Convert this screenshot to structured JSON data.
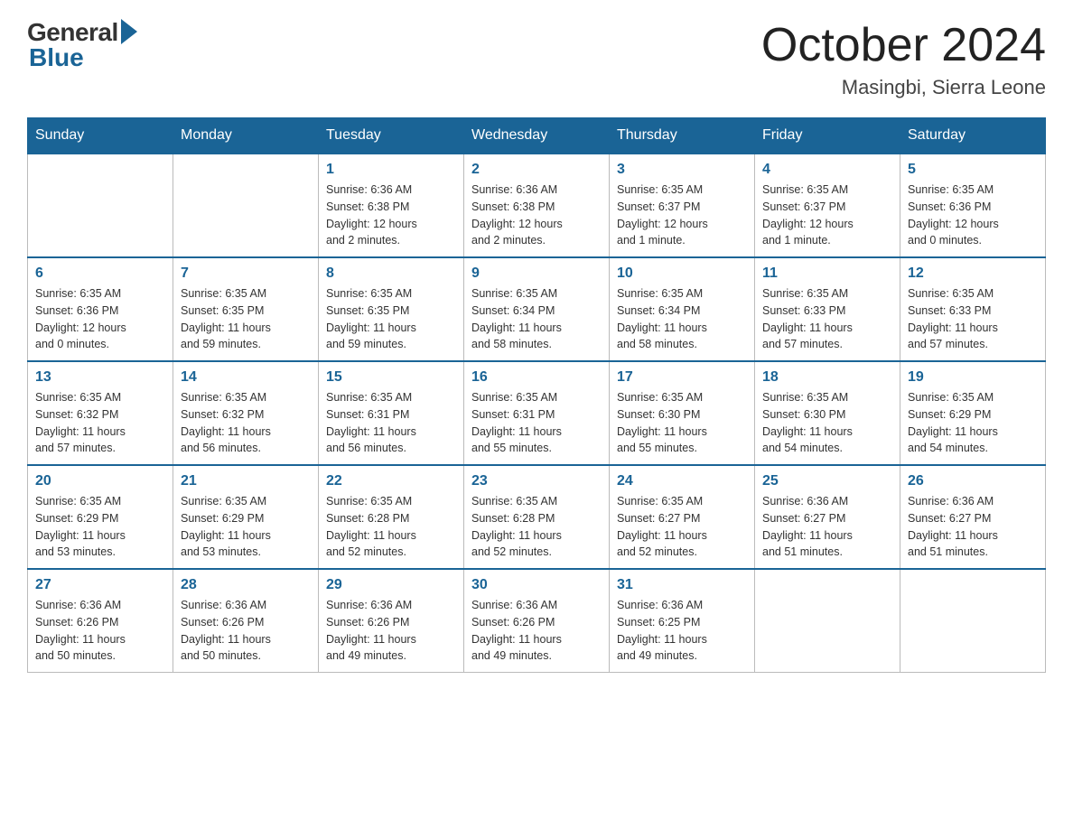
{
  "logo": {
    "general": "General",
    "blue": "Blue"
  },
  "header": {
    "month": "October 2024",
    "location": "Masingbi, Sierra Leone"
  },
  "weekdays": [
    "Sunday",
    "Monday",
    "Tuesday",
    "Wednesday",
    "Thursday",
    "Friday",
    "Saturday"
  ],
  "weeks": [
    [
      {
        "day": "",
        "info": ""
      },
      {
        "day": "",
        "info": ""
      },
      {
        "day": "1",
        "info": "Sunrise: 6:36 AM\nSunset: 6:38 PM\nDaylight: 12 hours\nand 2 minutes."
      },
      {
        "day": "2",
        "info": "Sunrise: 6:36 AM\nSunset: 6:38 PM\nDaylight: 12 hours\nand 2 minutes."
      },
      {
        "day": "3",
        "info": "Sunrise: 6:35 AM\nSunset: 6:37 PM\nDaylight: 12 hours\nand 1 minute."
      },
      {
        "day": "4",
        "info": "Sunrise: 6:35 AM\nSunset: 6:37 PM\nDaylight: 12 hours\nand 1 minute."
      },
      {
        "day": "5",
        "info": "Sunrise: 6:35 AM\nSunset: 6:36 PM\nDaylight: 12 hours\nand 0 minutes."
      }
    ],
    [
      {
        "day": "6",
        "info": "Sunrise: 6:35 AM\nSunset: 6:36 PM\nDaylight: 12 hours\nand 0 minutes."
      },
      {
        "day": "7",
        "info": "Sunrise: 6:35 AM\nSunset: 6:35 PM\nDaylight: 11 hours\nand 59 minutes."
      },
      {
        "day": "8",
        "info": "Sunrise: 6:35 AM\nSunset: 6:35 PM\nDaylight: 11 hours\nand 59 minutes."
      },
      {
        "day": "9",
        "info": "Sunrise: 6:35 AM\nSunset: 6:34 PM\nDaylight: 11 hours\nand 58 minutes."
      },
      {
        "day": "10",
        "info": "Sunrise: 6:35 AM\nSunset: 6:34 PM\nDaylight: 11 hours\nand 58 minutes."
      },
      {
        "day": "11",
        "info": "Sunrise: 6:35 AM\nSunset: 6:33 PM\nDaylight: 11 hours\nand 57 minutes."
      },
      {
        "day": "12",
        "info": "Sunrise: 6:35 AM\nSunset: 6:33 PM\nDaylight: 11 hours\nand 57 minutes."
      }
    ],
    [
      {
        "day": "13",
        "info": "Sunrise: 6:35 AM\nSunset: 6:32 PM\nDaylight: 11 hours\nand 57 minutes."
      },
      {
        "day": "14",
        "info": "Sunrise: 6:35 AM\nSunset: 6:32 PM\nDaylight: 11 hours\nand 56 minutes."
      },
      {
        "day": "15",
        "info": "Sunrise: 6:35 AM\nSunset: 6:31 PM\nDaylight: 11 hours\nand 56 minutes."
      },
      {
        "day": "16",
        "info": "Sunrise: 6:35 AM\nSunset: 6:31 PM\nDaylight: 11 hours\nand 55 minutes."
      },
      {
        "day": "17",
        "info": "Sunrise: 6:35 AM\nSunset: 6:30 PM\nDaylight: 11 hours\nand 55 minutes."
      },
      {
        "day": "18",
        "info": "Sunrise: 6:35 AM\nSunset: 6:30 PM\nDaylight: 11 hours\nand 54 minutes."
      },
      {
        "day": "19",
        "info": "Sunrise: 6:35 AM\nSunset: 6:29 PM\nDaylight: 11 hours\nand 54 minutes."
      }
    ],
    [
      {
        "day": "20",
        "info": "Sunrise: 6:35 AM\nSunset: 6:29 PM\nDaylight: 11 hours\nand 53 minutes."
      },
      {
        "day": "21",
        "info": "Sunrise: 6:35 AM\nSunset: 6:29 PM\nDaylight: 11 hours\nand 53 minutes."
      },
      {
        "day": "22",
        "info": "Sunrise: 6:35 AM\nSunset: 6:28 PM\nDaylight: 11 hours\nand 52 minutes."
      },
      {
        "day": "23",
        "info": "Sunrise: 6:35 AM\nSunset: 6:28 PM\nDaylight: 11 hours\nand 52 minutes."
      },
      {
        "day": "24",
        "info": "Sunrise: 6:35 AM\nSunset: 6:27 PM\nDaylight: 11 hours\nand 52 minutes."
      },
      {
        "day": "25",
        "info": "Sunrise: 6:36 AM\nSunset: 6:27 PM\nDaylight: 11 hours\nand 51 minutes."
      },
      {
        "day": "26",
        "info": "Sunrise: 6:36 AM\nSunset: 6:27 PM\nDaylight: 11 hours\nand 51 minutes."
      }
    ],
    [
      {
        "day": "27",
        "info": "Sunrise: 6:36 AM\nSunset: 6:26 PM\nDaylight: 11 hours\nand 50 minutes."
      },
      {
        "day": "28",
        "info": "Sunrise: 6:36 AM\nSunset: 6:26 PM\nDaylight: 11 hours\nand 50 minutes."
      },
      {
        "day": "29",
        "info": "Sunrise: 6:36 AM\nSunset: 6:26 PM\nDaylight: 11 hours\nand 49 minutes."
      },
      {
        "day": "30",
        "info": "Sunrise: 6:36 AM\nSunset: 6:26 PM\nDaylight: 11 hours\nand 49 minutes."
      },
      {
        "day": "31",
        "info": "Sunrise: 6:36 AM\nSunset: 6:25 PM\nDaylight: 11 hours\nand 49 minutes."
      },
      {
        "day": "",
        "info": ""
      },
      {
        "day": "",
        "info": ""
      }
    ]
  ]
}
